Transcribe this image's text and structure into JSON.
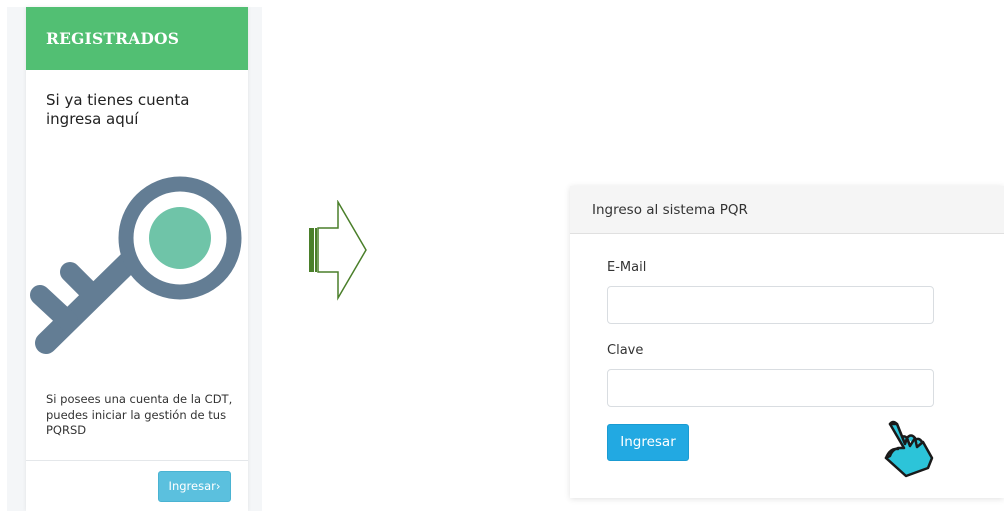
{
  "registered_card": {
    "header": "REGISTRADOS",
    "title": "Si ya tienes cuenta ingresa aquí",
    "description": "Si posees una cuenta de la CDT, puedes iniciar la gestión de tus PQRSD",
    "button_label": "Ingresar›",
    "icon": "key-icon"
  },
  "arrow": {
    "icon": "right-arrow-icon"
  },
  "login_panel": {
    "title": "Ingreso al sistema PQR",
    "email_label": "E-Mail",
    "email_value": "",
    "password_label": "Clave",
    "password_value": "",
    "submit_label": "Ingresar"
  },
  "cursor": {
    "icon": "hand-pointer-icon"
  },
  "colors": {
    "header_green": "#52bf73",
    "button_light_blue": "#5bc0de",
    "button_primary_blue": "#22a9e2",
    "key_gray_blue": "#637d94",
    "key_center_green": "#6fc4a8",
    "arrow_green": "#4a7f2a",
    "cursor_cyan": "#2cc4d9"
  }
}
